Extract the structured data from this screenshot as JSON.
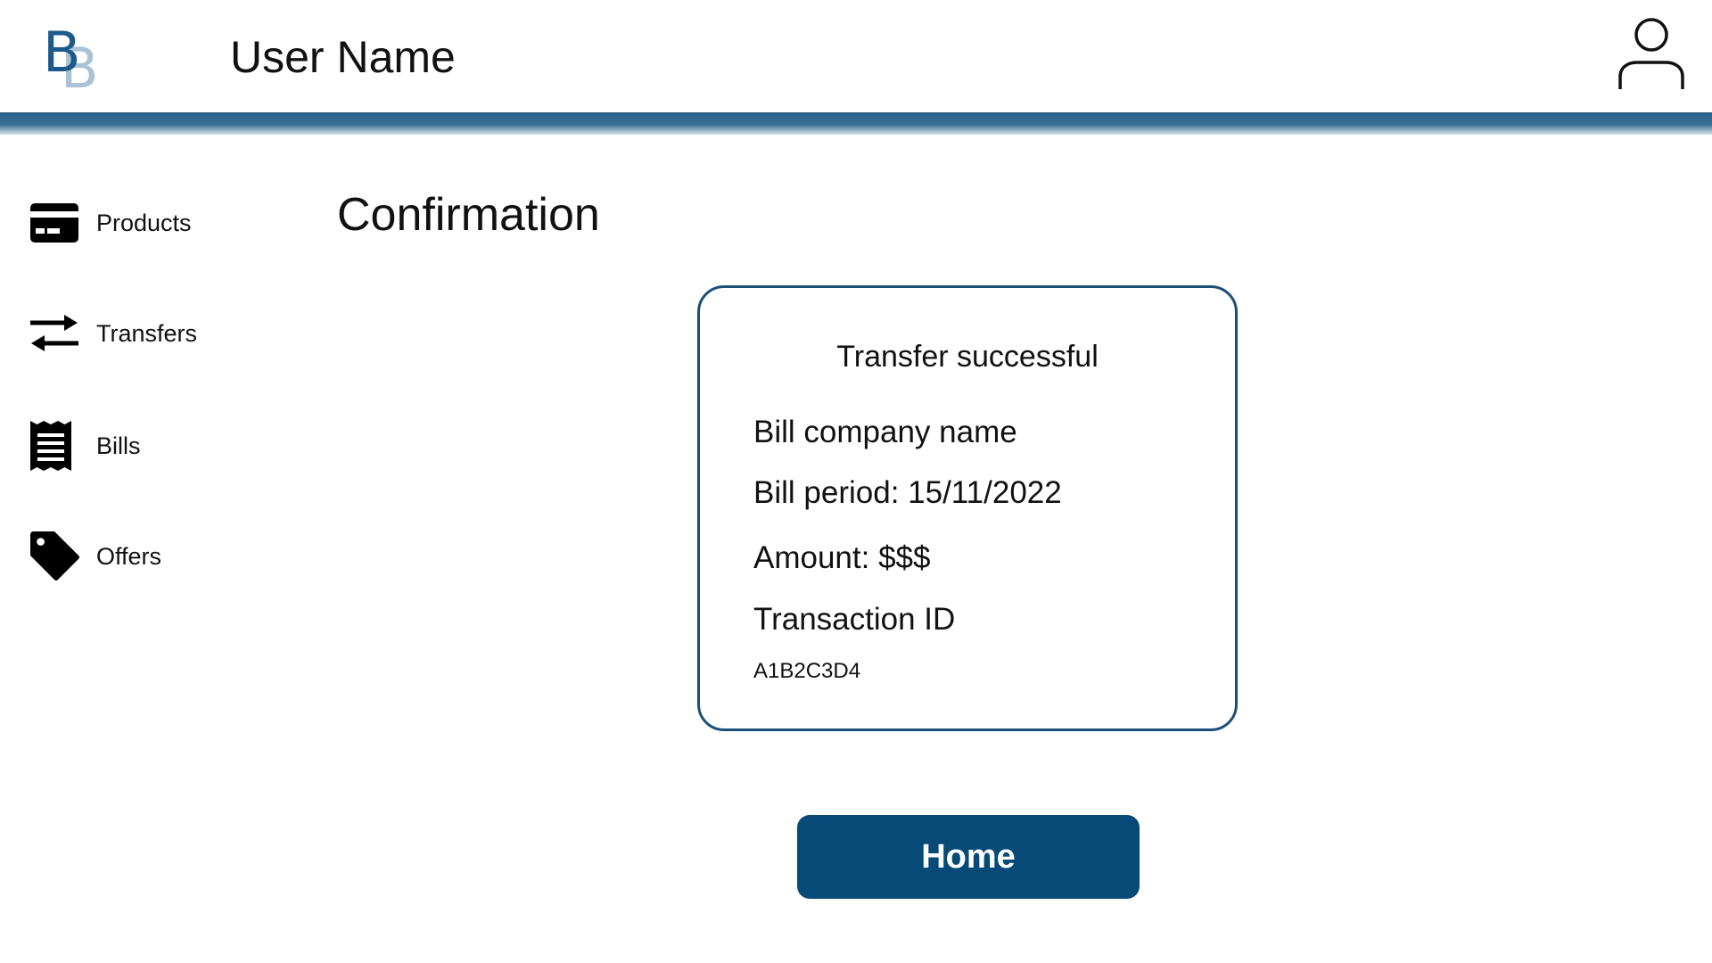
{
  "header": {
    "logo_letter_primary": "B",
    "logo_letter_secondary": "B",
    "username": "User Name",
    "icons": {
      "profile": "user-icon"
    }
  },
  "sidebar": {
    "items": [
      {
        "label": "Products",
        "icon": "credit-card-icon"
      },
      {
        "label": "Transfers",
        "icon": "transfer-arrows-icon"
      },
      {
        "label": "Bills",
        "icon": "receipt-icon"
      },
      {
        "label": "Offers",
        "icon": "tag-icon"
      }
    ]
  },
  "main": {
    "title": "Confirmation",
    "card": {
      "status": "Transfer successful",
      "company": "Bill company name",
      "period": "Bill period: 15/11/2022",
      "amount": "Amount: $$$",
      "transaction_label": "Transaction ID",
      "transaction_id": "A1B2C3D4"
    },
    "home_button_label": "Home"
  },
  "colors": {
    "brand_blue": "#074a78",
    "header_bar": "#2a5f85",
    "card_border": "#1c4f78",
    "logo_light": "#a9c2d6"
  }
}
